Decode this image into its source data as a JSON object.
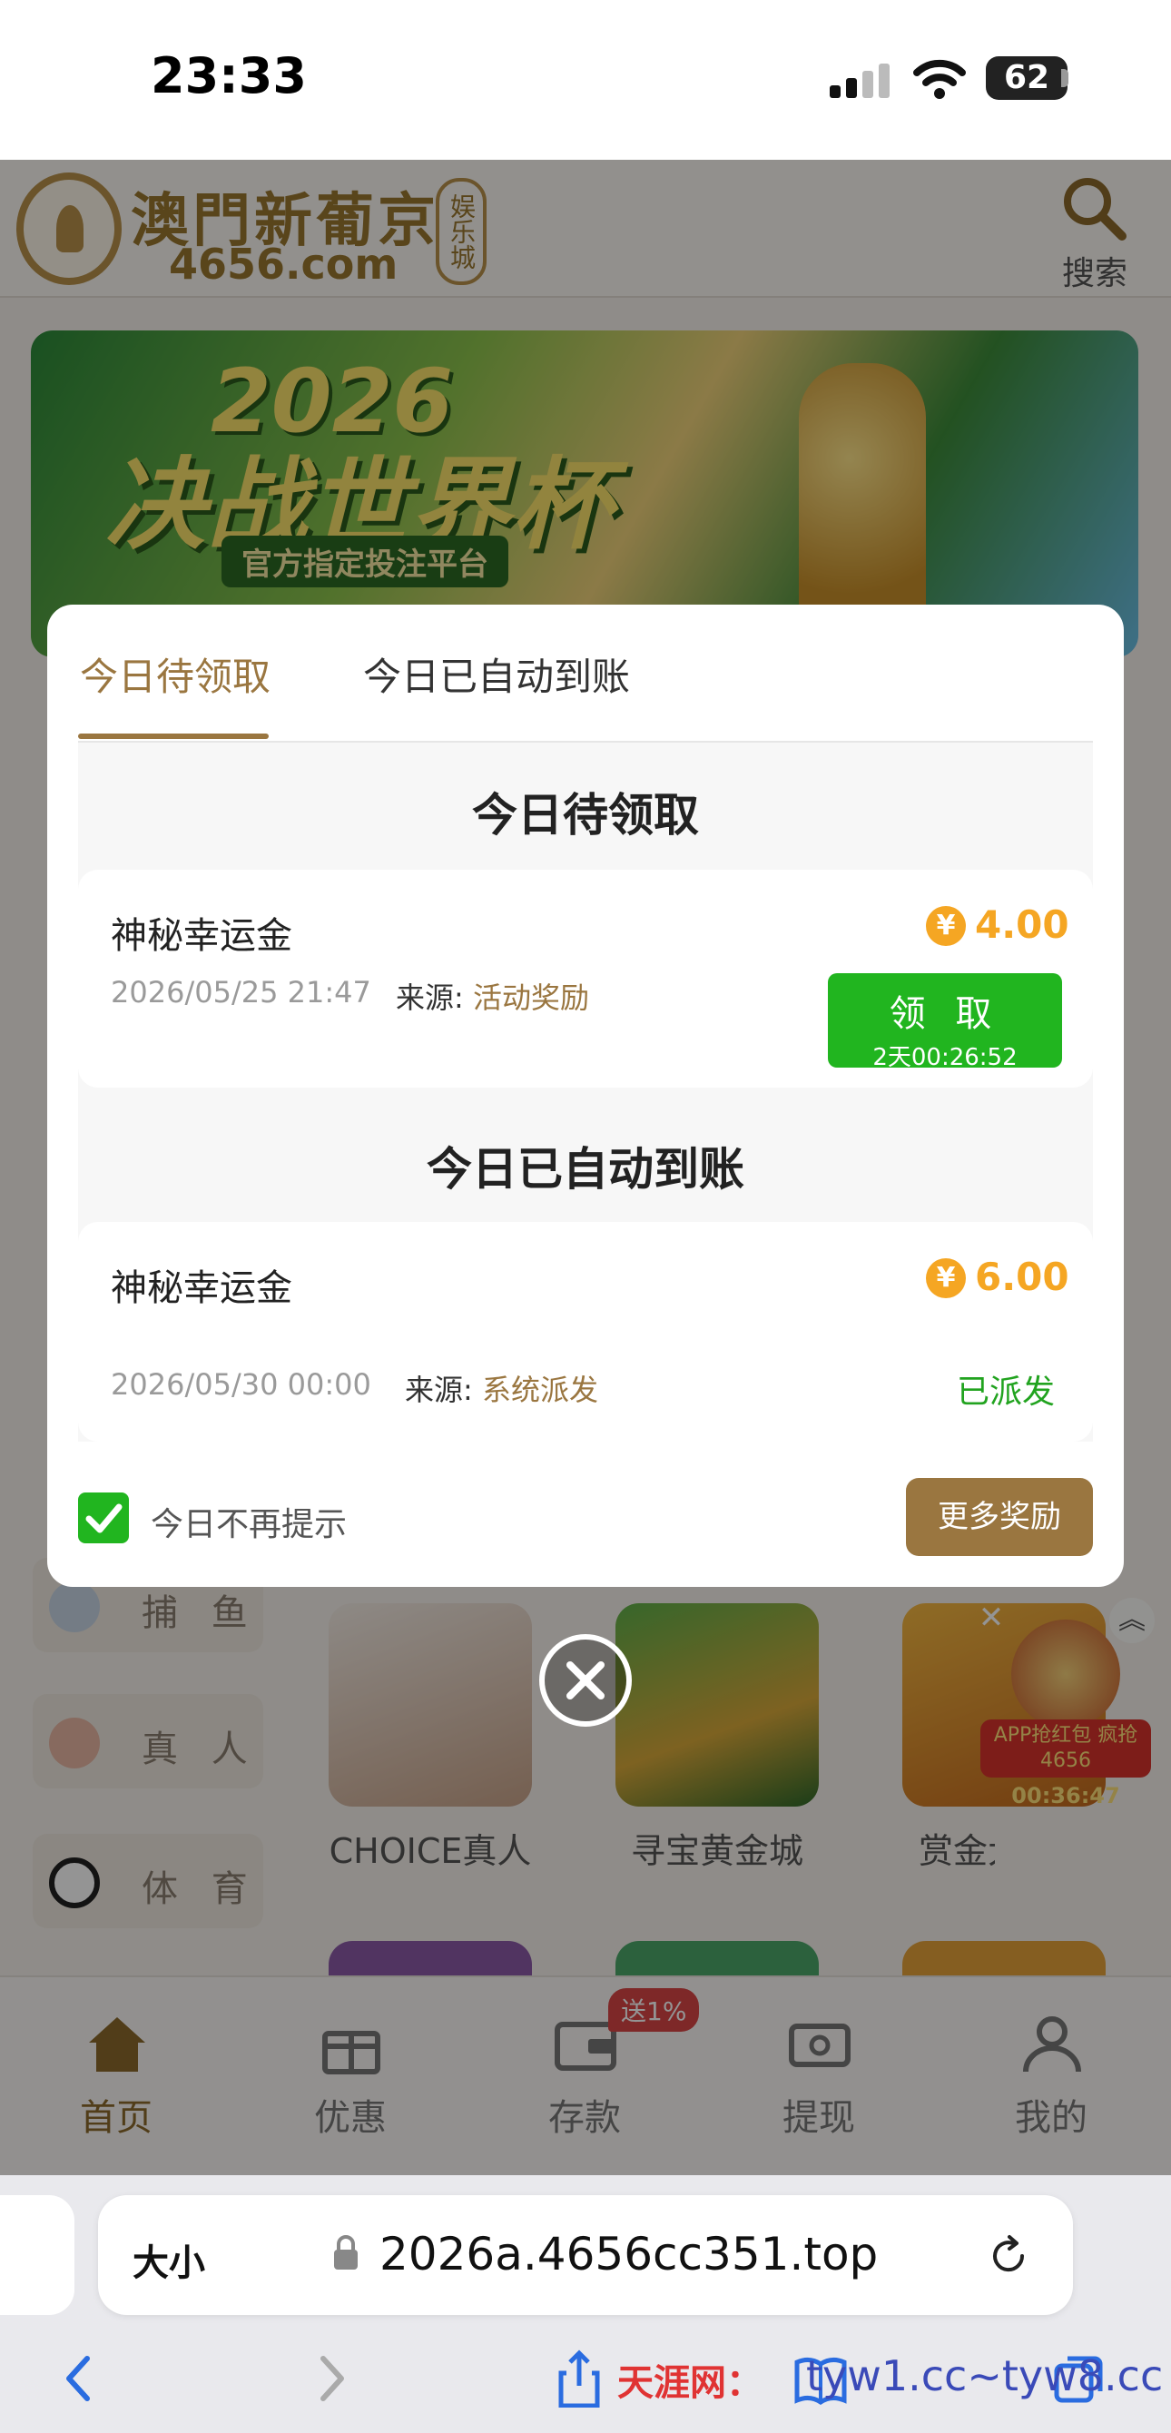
{
  "status_bar": {
    "time": "23:33",
    "battery": "62"
  },
  "site": {
    "name": "澳門新葡京",
    "domain": "4656.com",
    "badge": "娱乐城",
    "search_label": "搜索"
  },
  "banner": {
    "year": "2026",
    "title": "决战世界杯",
    "subtitle": "官方指定投注平台"
  },
  "categories": [
    "捕 鱼",
    "真 人",
    "体 育"
  ],
  "games": [
    {
      "label": "CHOICE真人"
    },
    {
      "label": "寻宝黄金城"
    },
    {
      "label": "赏金大"
    }
  ],
  "promo": {
    "text": "APP抢红包 疯抢4656",
    "timer": "00:36:47"
  },
  "bottom_nav": {
    "items": [
      "首页",
      "优惠",
      "存款",
      "提现",
      "我的"
    ],
    "deposit_badge": "送1%"
  },
  "modal": {
    "tabs": [
      "今日待领取",
      "今日已自动到账"
    ],
    "pending_title": "今日待领取",
    "auto_title": "今日已自动到账",
    "pending_item": {
      "name": "神秘幸运金",
      "amount": "4.00",
      "date": "2026/05/25 21:47",
      "source_label": "来源:",
      "source": "活动奖励",
      "button": "领 取",
      "countdown": "2天00:26:52"
    },
    "auto_item": {
      "name": "神秘幸运金",
      "amount": "6.00",
      "date": "2026/05/30 00:00",
      "source_label": "来源:",
      "source": "系统派发",
      "status": "已派发"
    },
    "currency_symbol": "¥",
    "dont_remind": "今日不再提示",
    "more_rewards": "更多奖励"
  },
  "safari": {
    "text_size": "大小",
    "url": "2026a.4656cc351.top"
  },
  "watermark": {
    "text": "天涯网：",
    "url": "tyw1.cc~tyw8.cc"
  },
  "colors": {
    "accent": "#9a7640",
    "claim_green": "#21b51f",
    "coin": "#f5a623"
  }
}
